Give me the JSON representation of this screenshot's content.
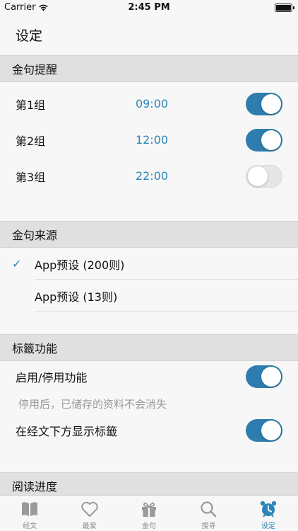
{
  "status_bar": {
    "carrier": "Carrier",
    "time": "2:45 PM"
  },
  "header": {
    "title": "设定"
  },
  "reminders": {
    "header": "金句提醒",
    "items": [
      {
        "label": "第1组",
        "time": "09:00",
        "enabled": true
      },
      {
        "label": "第2组",
        "time": "12:00",
        "enabled": true
      },
      {
        "label": "第3组",
        "time": "22:00",
        "enabled": false
      }
    ]
  },
  "sources": {
    "header": "金句来源",
    "items": [
      {
        "label": "App预设 (200则)",
        "selected": true
      },
      {
        "label": "App预设 (13则)",
        "selected": false
      }
    ]
  },
  "tags": {
    "header": "标籤功能",
    "enable_label": "启用/停用功能",
    "enable_on": true,
    "hint": "停用后，已储存的资料不会消失",
    "show_label": "在经文下方显示标籤",
    "show_on": true
  },
  "reading": {
    "header": "阅读进度",
    "partial_label": "",
    "partial_on": true
  },
  "tab_bar": {
    "items": [
      {
        "label": "经文",
        "icon": "book-icon"
      },
      {
        "label": "最爱",
        "icon": "heart-icon"
      },
      {
        "label": "金句",
        "icon": "gift-icon"
      },
      {
        "label": "搜寻",
        "icon": "search-icon"
      },
      {
        "label": "设定",
        "icon": "alarm-clock-icon",
        "active": true
      }
    ]
  },
  "colors": {
    "accent": "#2b87b9",
    "toggle_on": "#2e7dae",
    "section_bg": "#e0e0e0",
    "page_bg": "#f7f7f7"
  }
}
